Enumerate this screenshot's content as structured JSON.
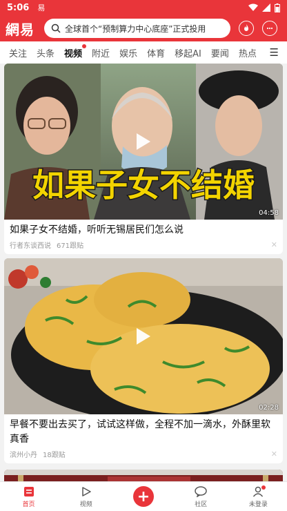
{
  "status": {
    "time": "5:06",
    "app_glyph": "易"
  },
  "header": {
    "logo": "網易",
    "search_placeholder": "全球首个“预制算力中心底座”正式投用"
  },
  "tabs": [
    "关注",
    "头条",
    "视频",
    "附近",
    "娱乐",
    "体育",
    "移起AI",
    "要闻",
    "热点"
  ],
  "active_tab": "视频",
  "feed": [
    {
      "overlay_text": "如果子女不结婚",
      "duration": "04:58",
      "title": "如果子女不结婚，听听无锡居民们怎么说",
      "source": "行者东谈西说",
      "comments": "671跟贴"
    },
    {
      "duration": "02:28",
      "title": "早餐不要出去买了，试试这样做，全程不加一滴水，外酥里软真香",
      "source": "滨州小丹",
      "comments": "18跟贴"
    }
  ],
  "bottom_nav": {
    "home": "首页",
    "video": "视频",
    "community": "社区",
    "profile": "未登录"
  },
  "colors": {
    "accent": "#e9353a"
  }
}
